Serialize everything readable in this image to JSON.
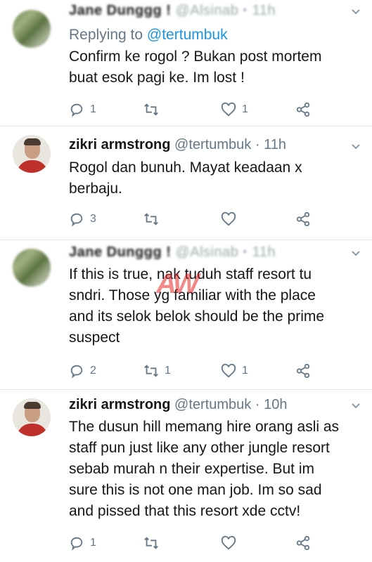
{
  "tweets": [
    {
      "name": "Jane Dunggg !",
      "handle": "@Alsinab",
      "time": "11h",
      "reply_prefix": "Replying to",
      "reply_to": "@tertumbuk",
      "text_lines": [
        "Confirm ke rogol ? Bukan post mortem",
        "buat esok pagi ke. Im lost !"
      ],
      "replies": "1",
      "retweets": "",
      "likes": "1"
    },
    {
      "name": "zikri armstrong",
      "handle": "@tertumbuk",
      "time": "11h",
      "text_lines": [
        "Rogol dan bunuh. Mayat keadaan x",
        "berbaju."
      ],
      "replies": "3",
      "retweets": "",
      "likes": ""
    },
    {
      "name": "Jane Dunggg !",
      "handle": "@Alsinab",
      "time": "11h",
      "text_lines": [
        "If this is true, nak tuduh staff resort tu",
        "sndri. Those yg familiar with the place",
        "and its selok belok should be the prime",
        "suspect"
      ],
      "replies": "2",
      "retweets": "1",
      "likes": "1"
    },
    {
      "name": "zikri armstrong",
      "handle": "@tertumbuk",
      "time": "10h",
      "text_lines": [
        "The dusun hill memang hire orang asli as",
        "staff pun just like any other jungle resort",
        "sebab murah n their expertise. But im",
        "sure this is not one man job. Im so sad",
        "and pissed that this resort xde cctv!"
      ],
      "replies": "1",
      "retweets": "",
      "likes": ""
    }
  ],
  "watermark": "AW",
  "dot": "·"
}
